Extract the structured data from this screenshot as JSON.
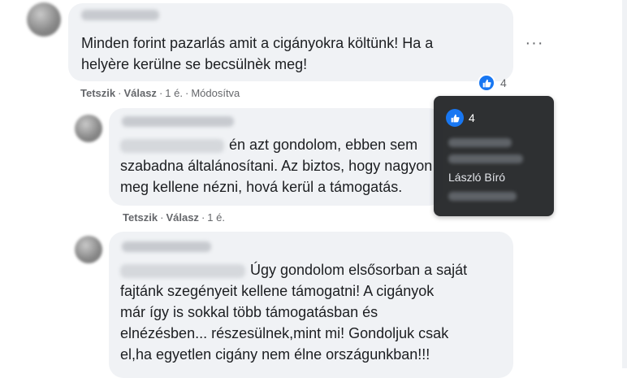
{
  "comment1": {
    "text_line1": "Minden forint pazarlás amit a cigányokra költünk! Ha a",
    "text_line2": "helyère kerülne se becsülnèk meg!",
    "like": "Tetszik",
    "reply": "Válasz",
    "time": "1 é.",
    "edited": "Módosítva",
    "reaction_count": "4"
  },
  "comment2": {
    "text_line1": "én azt gondolom, ebben sem",
    "text_line2": "szabadna általánosítani. Az biztos, hogy nagyon",
    "text_line3": "meg kellene nézni, hová kerül a támogatás.",
    "like": "Tetszik",
    "reply": "Válasz",
    "time": "1 é."
  },
  "comment3": {
    "text_line1": "Úgy gondolom elsősorban a saját",
    "text_line2": "fajtánk szegényeit kellene támogatni! A cigányok",
    "text_line3": "már így is sokkal több támogatásban és",
    "text_line4": "elnézésben... részesülnek,mint mi! Gondoljuk csak",
    "text_line5": "el,ha egyetlen cigány nem élne országunkban!!!"
  },
  "tooltip": {
    "count": "4",
    "visible_name": "László Bíró"
  },
  "icons": {
    "like": "thumbs-up-icon",
    "more": "more-options-icon"
  },
  "colors": {
    "accent": "#1877f2",
    "bubble": "#f0f2f5",
    "meta": "#65676b"
  }
}
